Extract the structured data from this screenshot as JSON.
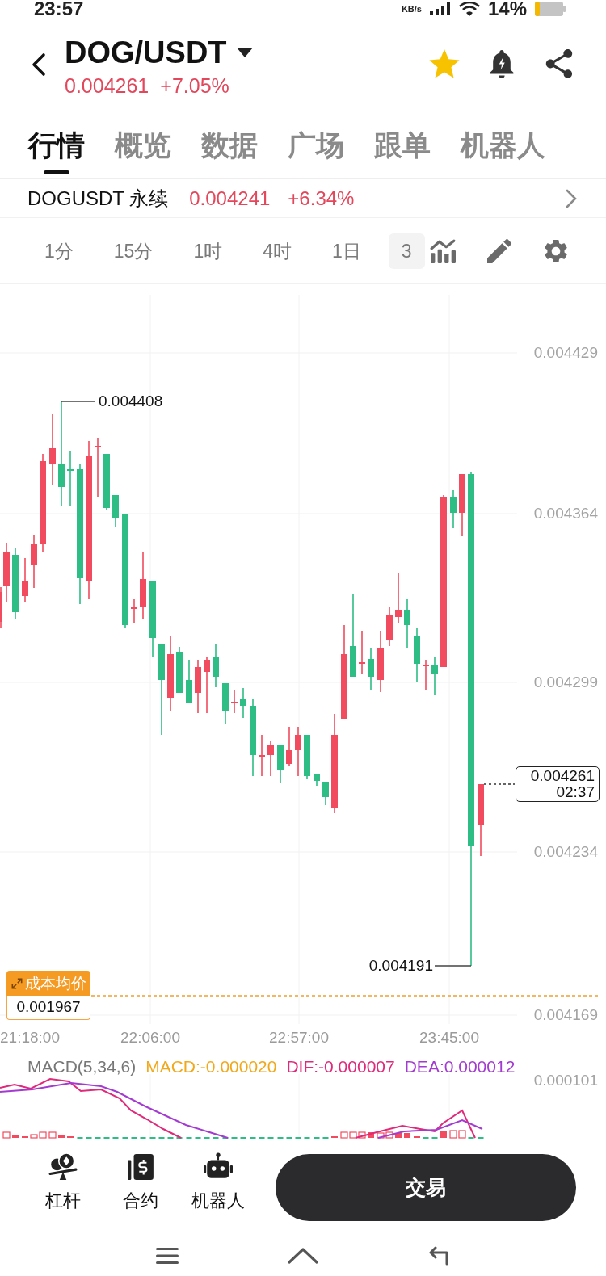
{
  "status_bar": {
    "time": "23:57",
    "network_unit": "KB/s",
    "battery": "14%"
  },
  "header": {
    "pair": "DOG/USDT",
    "price": "0.004261",
    "change": "+7.05%",
    "favorite": true
  },
  "tabs": [
    {
      "label": "行情",
      "selected": true
    },
    {
      "label": "概览",
      "selected": false
    },
    {
      "label": "数据",
      "selected": false
    },
    {
      "label": "广场",
      "selected": false
    },
    {
      "label": "跟单",
      "selected": false
    },
    {
      "label": "机器人",
      "selected": false
    }
  ],
  "perpetual": {
    "name": "DOGUSDT 永续",
    "price": "0.004241",
    "change": "+6.34%"
  },
  "intervals": [
    {
      "label": "1分",
      "selected": false
    },
    {
      "label": "15分",
      "selected": false
    },
    {
      "label": "1时",
      "selected": false
    },
    {
      "label": "4时",
      "selected": false
    },
    {
      "label": "1日",
      "selected": false
    },
    {
      "label": "3",
      "selected": true
    }
  ],
  "chart": {
    "price_axis": [
      "0.004429",
      "0.004364",
      "0.004299",
      "0.004234",
      "0.004169"
    ],
    "time_axis": [
      "21:18:00",
      "22:06:00",
      "22:57:00",
      "23:45:00"
    ],
    "high_label": "0.004408",
    "low_label": "0.004191",
    "last_price": {
      "price": "0.004261",
      "countdown": "02:37"
    },
    "cost_average": {
      "label": "成本均价",
      "value": "0.001967"
    }
  },
  "macd": {
    "title": "MACD(5,34,6)",
    "values": [
      {
        "text": "MACD:-0.000020",
        "color": "#f0a91c"
      },
      {
        "text": "DIF:-0.000007",
        "color": "#e0297a"
      },
      {
        "text": "DEA:0.000012",
        "color": "#a43bd1"
      }
    ],
    "scale_label": "0.000101"
  },
  "bottom_nav": [
    {
      "label": "杠杆"
    },
    {
      "label": "合约"
    },
    {
      "label": "机器人"
    }
  ],
  "trade_button": "交易"
}
